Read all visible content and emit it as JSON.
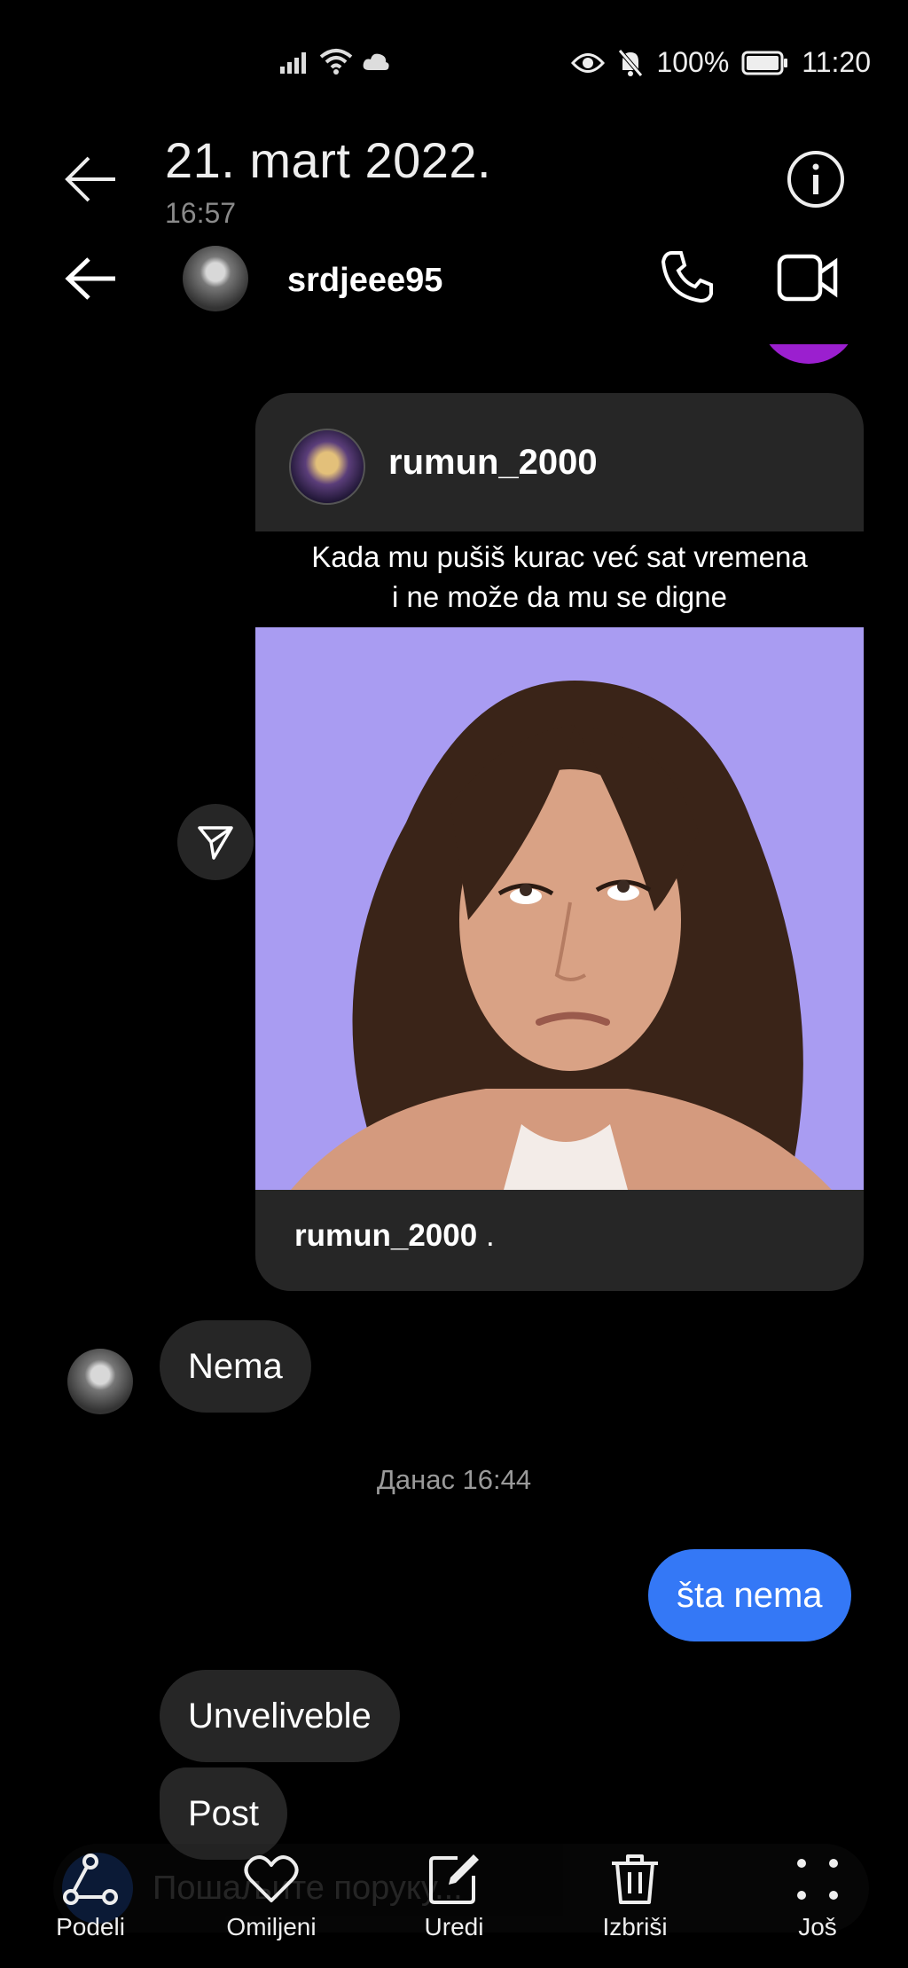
{
  "status_bar": {
    "battery": "100%",
    "time": "11:20"
  },
  "gallery_header": {
    "date": "21. mart 2022.",
    "time": "16:57"
  },
  "chat_header": {
    "username": "srdjeee95"
  },
  "post": {
    "author": "rumun_2000",
    "caption_line1": "Kada mu pušiš kurac već sat vremena",
    "caption_line2": "i ne može da mu se digne",
    "footer_user": "rumun_2000",
    "footer_text": " ."
  },
  "messages": {
    "in_1": "Nema",
    "timestamp": "Данас 16:44",
    "out_1": "šta nema",
    "in_2": "Unveliveble",
    "in_3": "Post"
  },
  "composer": {
    "placeholder": "Пошаљите поруку..."
  },
  "toolbar": {
    "share": "Podeli",
    "favorite": "Omiljeni",
    "edit": "Uredi",
    "delete": "Izbriši",
    "more": "Još"
  },
  "colors": {
    "accent_blue": "#3478f6",
    "bubble_gray": "#262626",
    "image_bg": "#a99cf2"
  }
}
